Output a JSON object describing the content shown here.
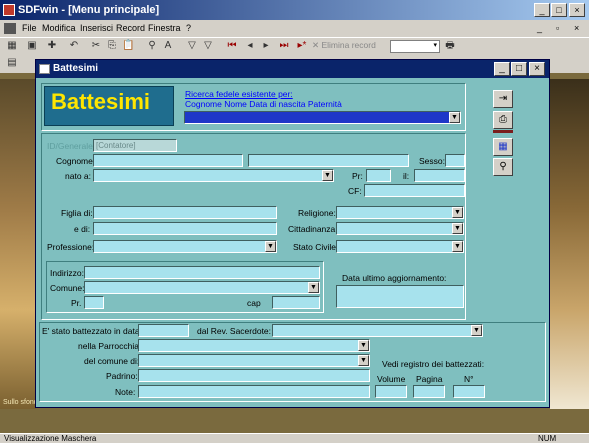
{
  "app": {
    "title": "SDFwin - [Menu principale]",
    "icon": "app-icon"
  },
  "menubar": {
    "items": [
      "File",
      "Modifica",
      "Inserisci",
      "Record",
      "Finestra",
      "?"
    ]
  },
  "toolbar": {
    "elimina_label": "Elimina record"
  },
  "window": {
    "title": "Battesimi"
  },
  "header": {
    "banner": "Battesimi",
    "search_link": "Ricerca fedele esistente per:",
    "search_fields": "Cognome Nome Data di nascita Paternità"
  },
  "person": {
    "id_label": "ID/Generale",
    "id_value": "[Contatore]",
    "cognome_label": "Cognome:",
    "sesso_label": "Sesso:",
    "nato_label": "nato a:",
    "pr_label": "Pr:",
    "il_label": "il:",
    "cf_label": "CF:",
    "figlia_label": "Figlia di:",
    "e_di_label": "e di:",
    "professione_label": "Professione:",
    "religione_label": "Religione:",
    "cittadinanza_label": "Cittadinanza:",
    "stato_civile_label": "Stato Civile:"
  },
  "address": {
    "indirizzo_label": "Indirizzo:",
    "comune_label": "Comune:",
    "pr_label": "Pr.",
    "cap_label": "cap",
    "aggiornamento_label": "Data ultimo aggiornamento:"
  },
  "baptism": {
    "data_label": "E' stato battezzato in data:",
    "sacerdote_label": "dal Rev. Sacerdote:",
    "parrocchia_label": "nella Parrocchia:",
    "comune_label": "del comune di:",
    "padrino_label": "Padrino:",
    "note_label": "Note:",
    "registro_label": "Vedi registro dei battezzati:",
    "volume_label": "Volume",
    "pagina_label": "Pagina",
    "numero_label": "N°"
  },
  "statusbar": {
    "left": "Visualizzazione Maschera",
    "right": "NUM"
  },
  "background": {
    "caption": "Sullo sfondo"
  }
}
